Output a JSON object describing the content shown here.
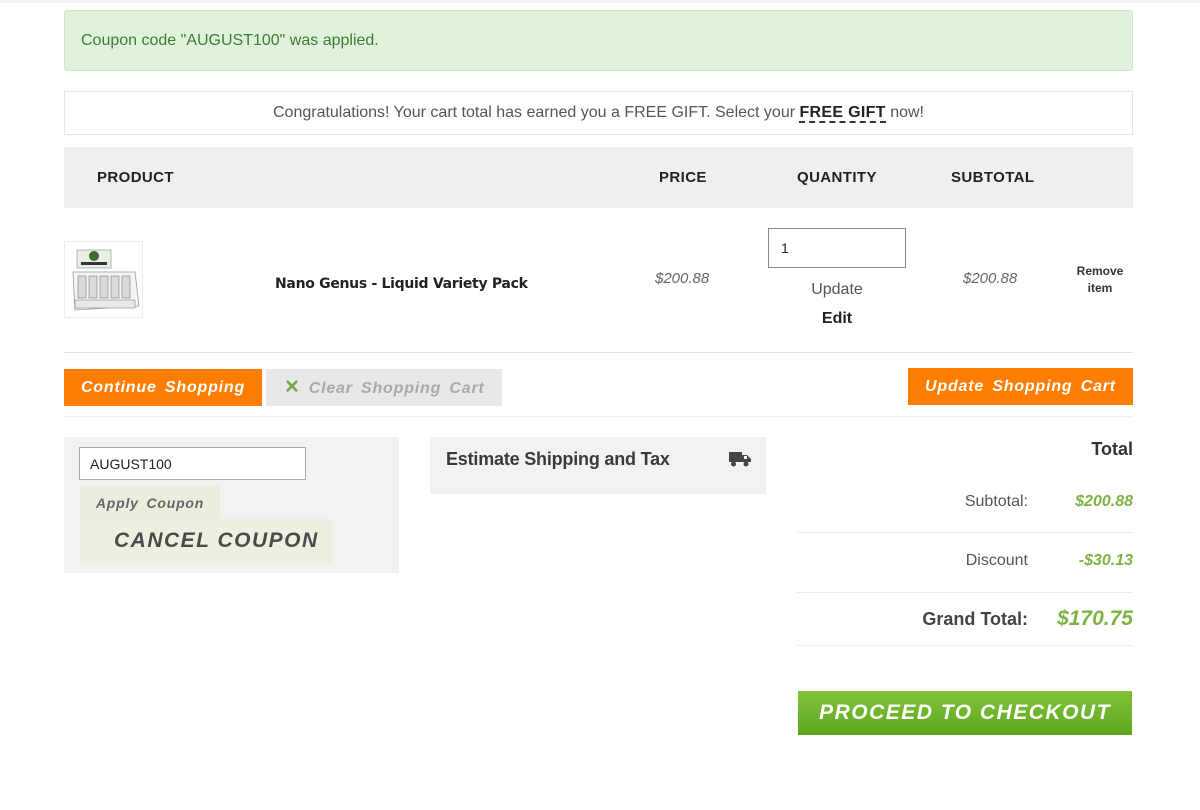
{
  "messages": {
    "coupon_applied": "Coupon code \"AUGUST100\" was applied.",
    "gift_prefix": "Congratulations! Your cart total has earned you a FREE GIFT. Select your ",
    "gift_link": "FREE GIFT",
    "gift_suffix": " now!"
  },
  "cart": {
    "headers": {
      "product": "PRODUCT",
      "price": "PRICE",
      "quantity": "QUANTITY",
      "subtotal": "SUBTOTAL"
    },
    "items": [
      {
        "name": "Nano Genus - Liquid Variety Pack",
        "price": "$200.88",
        "quantity": "1",
        "update_label": "Update",
        "edit_label": "Edit",
        "subtotal": "$200.88",
        "remove_label": "Remove item"
      }
    ]
  },
  "actions": {
    "continue_shopping": "Continue Shopping",
    "clear_cart": "Clear Shopping Cart",
    "update_cart": "Update Shopping Cart"
  },
  "coupon": {
    "value": "AUGUST100",
    "apply_label": "Apply Coupon",
    "cancel_label": "CANCEL COUPON"
  },
  "shipping": {
    "title": "Estimate Shipping and Tax",
    "icon": "truck-icon"
  },
  "totals": {
    "title": "Total",
    "subtotal_label": "Subtotal:",
    "subtotal_value": "$200.88",
    "discount_label": "Discount",
    "discount_value": "-$30.13",
    "grand_total_label": "Grand Total:",
    "grand_total_value": "$170.75"
  },
  "checkout": {
    "label": "PROCEED TO CHECKOUT"
  },
  "colors": {
    "accent_orange": "#ff7d00",
    "accent_green": "#7cb342",
    "success_bg": "#e1f2dc"
  }
}
